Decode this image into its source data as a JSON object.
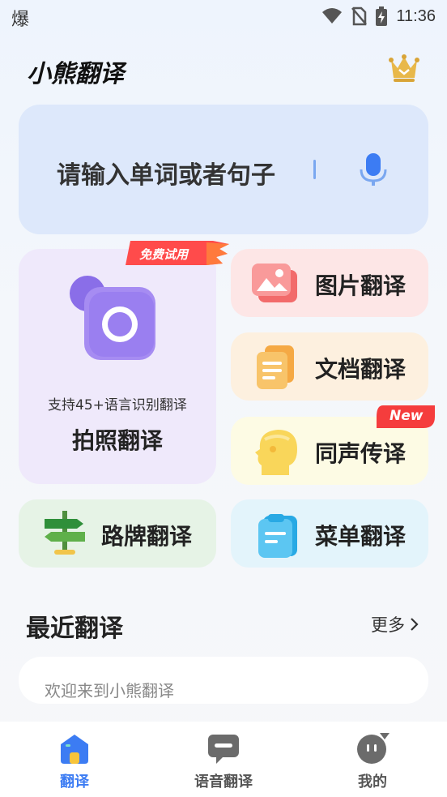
{
  "status_bar": {
    "left_glyph": "爆",
    "time": "11:36",
    "icons": [
      "wifi-icon",
      "no-sim-icon",
      "battery-charging-icon"
    ]
  },
  "header": {
    "title": "小熊翻译",
    "vip_icon": "crown-icon"
  },
  "search": {
    "placeholder": "请输入单词或者句子",
    "mic_icon": "microphone-icon"
  },
  "photo_translate": {
    "badge": "免费试用",
    "subtitle": "支持45+语言识别翻译",
    "label": "拍照翻译",
    "icon": "camera-icon"
  },
  "features": {
    "image": {
      "label": "图片翻译",
      "icon": "image-icon"
    },
    "document": {
      "label": "文档翻译",
      "icon": "document-icon"
    },
    "simultaneous": {
      "label": "同声传译",
      "icon": "head-icon",
      "badge": "New"
    },
    "roadsign": {
      "label": "路牌翻译",
      "icon": "signpost-icon"
    },
    "menu": {
      "label": "菜单翻译",
      "icon": "clipboard-icon"
    }
  },
  "recent": {
    "title": "最近翻译",
    "more": "更多",
    "items": [
      "欢迎来到小熊翻译"
    ]
  },
  "tabs": [
    {
      "label": "翻译",
      "icon": "home-icon",
      "active": true
    },
    {
      "label": "语音翻译",
      "icon": "chat-icon",
      "active": false
    },
    {
      "label": "我的",
      "icon": "profile-icon",
      "active": false
    }
  ],
  "colors": {
    "accent": "#3c7cf3",
    "inactive": "#555555"
  }
}
